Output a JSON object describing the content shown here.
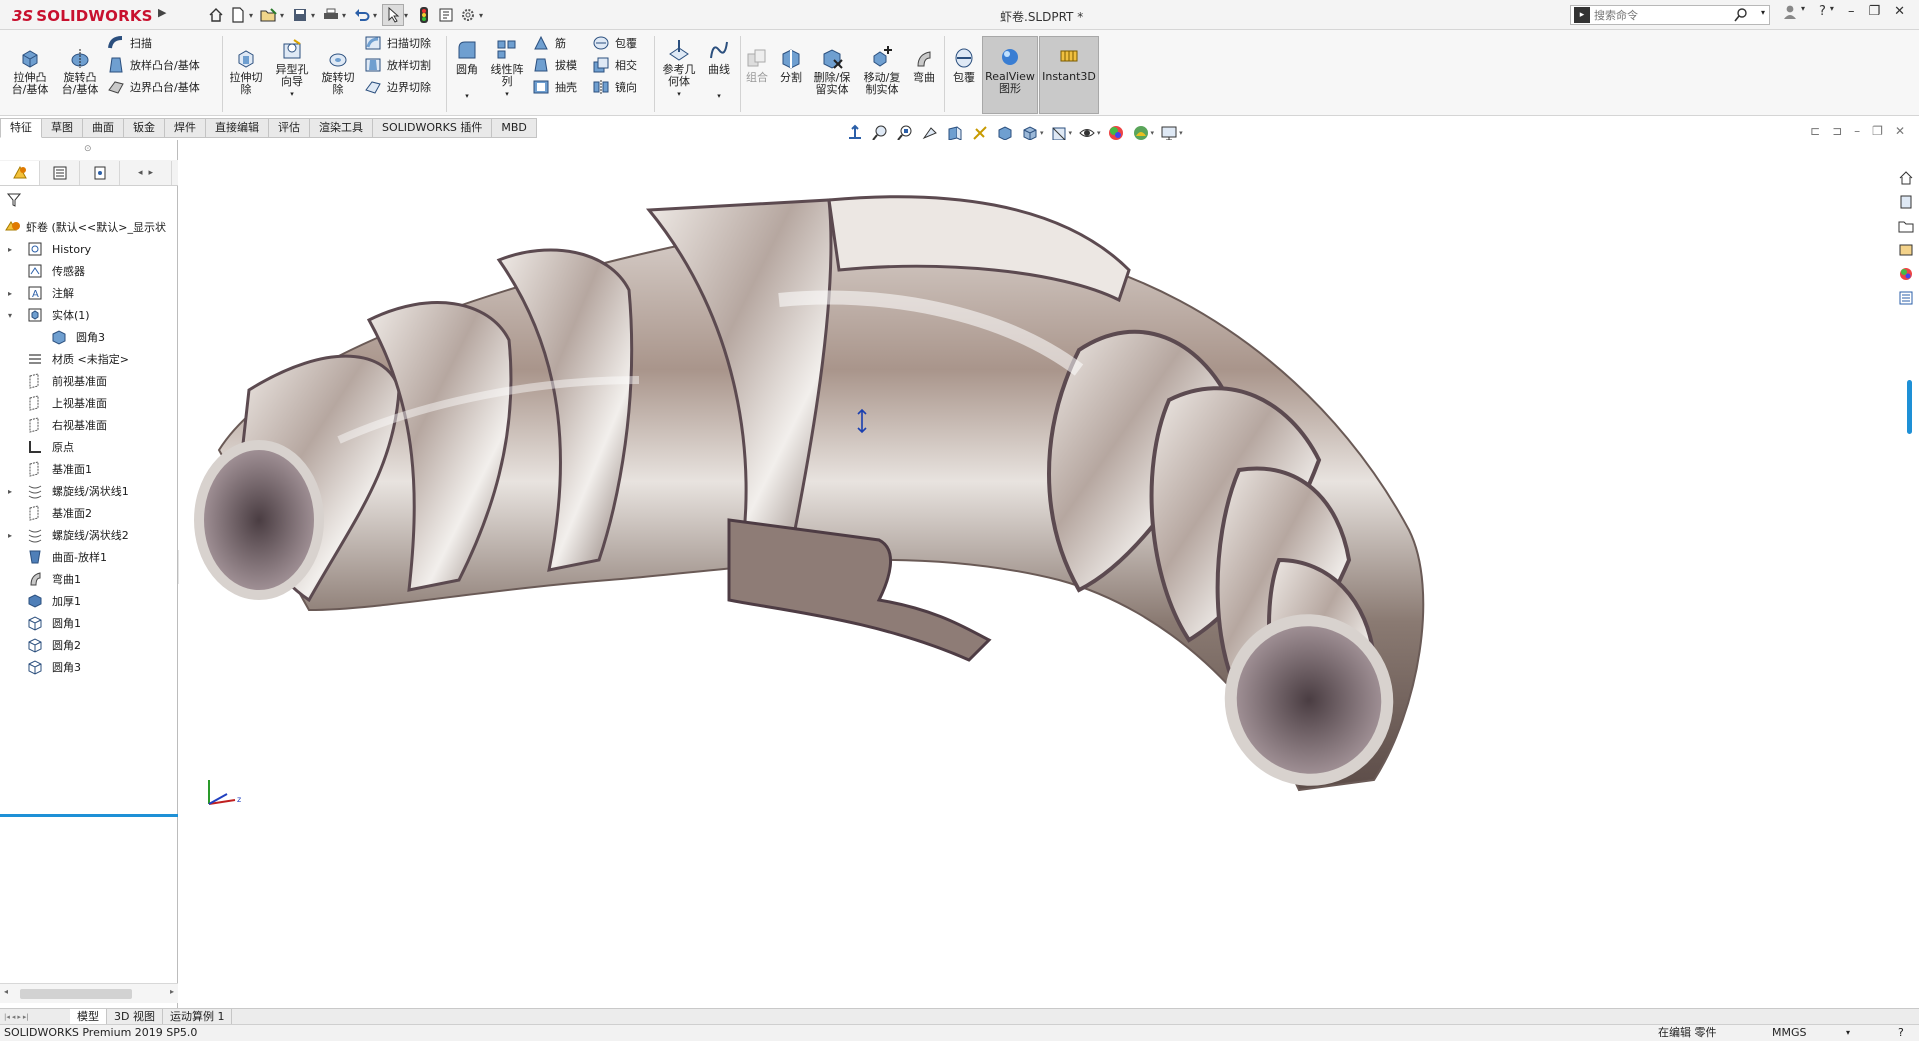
{
  "app": {
    "logo_ds": "3S",
    "logo_name": "SOLIDWORKS",
    "document_title": "虾卷.SLDPRT *"
  },
  "search": {
    "placeholder": "搜索命令"
  },
  "commands": {
    "extrude_boss": "拉伸凸\n台/基体",
    "revolve_boss": "旋转凸\n台/基体",
    "sweep": "扫描",
    "loft_boss": "放样凸台/基体",
    "boundary_boss": "边界凸台/基体",
    "extrude_cut": "拉伸切\n除",
    "hole_wizard": "异型孔\n向导",
    "revolve_cut": "旋转切\n除",
    "sweep_cut": "扫描切除",
    "loft_cut": "放样切割",
    "boundary_cut": "边界切除",
    "fillet": "圆角",
    "linear_pattern": "线性阵\n列",
    "rib": "筋",
    "draft": "拔模",
    "shell": "抽壳",
    "wrap": "包覆",
    "intersect": "相交",
    "mirror": "镜向",
    "ref_geometry": "参考几\n何体",
    "curves": "曲线",
    "combine": "组合",
    "split": "分割",
    "delete_keep_body": "删除/保\n留实体",
    "move_copy_body": "移动/复\n制实体",
    "flex": "弯曲",
    "wrap2": "包覆",
    "realview": "RealView\n图形",
    "instant3d": "Instant3D"
  },
  "tabs": [
    "特征",
    "草图",
    "曲面",
    "钣金",
    "焊件",
    "直接编辑",
    "评估",
    "渲染工具",
    "SOLIDWORKS 插件",
    "MBD"
  ],
  "feature_tree": {
    "root": "虾卷 (默认<<默认>_显示状",
    "items": [
      {
        "label": "History",
        "icon": "history-icon",
        "arrow": "▸",
        "indent": 0
      },
      {
        "label": "传感器",
        "icon": "sensor-icon",
        "arrow": "",
        "indent": 0
      },
      {
        "label": "注解",
        "icon": "annotation-icon",
        "arrow": "▸",
        "indent": 0
      },
      {
        "label": "实体(1)",
        "icon": "solid-bodies-icon",
        "arrow": "▾",
        "indent": 0
      },
      {
        "label": "圆角3",
        "icon": "solid-body-icon",
        "arrow": "",
        "indent": 1
      },
      {
        "label": "材质 <未指定>",
        "icon": "material-icon",
        "arrow": "",
        "indent": 0
      },
      {
        "label": "前视基准面",
        "icon": "plane-icon",
        "arrow": "",
        "indent": 0
      },
      {
        "label": "上视基准面",
        "icon": "plane-icon",
        "arrow": "",
        "indent": 0
      },
      {
        "label": "右视基准面",
        "icon": "plane-icon",
        "arrow": "",
        "indent": 0
      },
      {
        "label": "原点",
        "icon": "origin-icon",
        "arrow": "",
        "indent": 0
      },
      {
        "label": "基准面1",
        "icon": "plane-icon",
        "arrow": "",
        "indent": 0
      },
      {
        "label": "螺旋线/涡状线1",
        "icon": "helix-icon",
        "arrow": "▸",
        "indent": 0
      },
      {
        "label": "基准面2",
        "icon": "plane-icon",
        "arrow": "",
        "indent": 0
      },
      {
        "label": "螺旋线/涡状线2",
        "icon": "helix-icon",
        "arrow": "▸",
        "indent": 0
      },
      {
        "label": "曲面-放样1",
        "icon": "surface-loft-icon",
        "arrow": "",
        "indent": 0
      },
      {
        "label": "弯曲1",
        "icon": "flex-icon",
        "arrow": "",
        "indent": 0
      },
      {
        "label": "加厚1",
        "icon": "thicken-icon",
        "arrow": "",
        "indent": 0
      },
      {
        "label": "圆角1",
        "icon": "fillet-icon",
        "arrow": "",
        "indent": 0
      },
      {
        "label": "圆角2",
        "icon": "fillet-icon",
        "arrow": "",
        "indent": 0
      },
      {
        "label": "圆角3",
        "icon": "fillet-icon",
        "arrow": "",
        "indent": 0
      }
    ]
  },
  "bottom_tabs": [
    "模型",
    "3D 视图",
    "运动算例 1"
  ],
  "status": {
    "product": "SOLIDWORKS Premium 2019 SP5.0",
    "mode": "在编辑 零件",
    "units": "MMGS",
    "units_arrow": "▾"
  },
  "colors": {
    "brand": "#c8102e",
    "selection": "#1e90d6",
    "model_metal": "#b8a89f",
    "model_edge": "#5a4654"
  }
}
